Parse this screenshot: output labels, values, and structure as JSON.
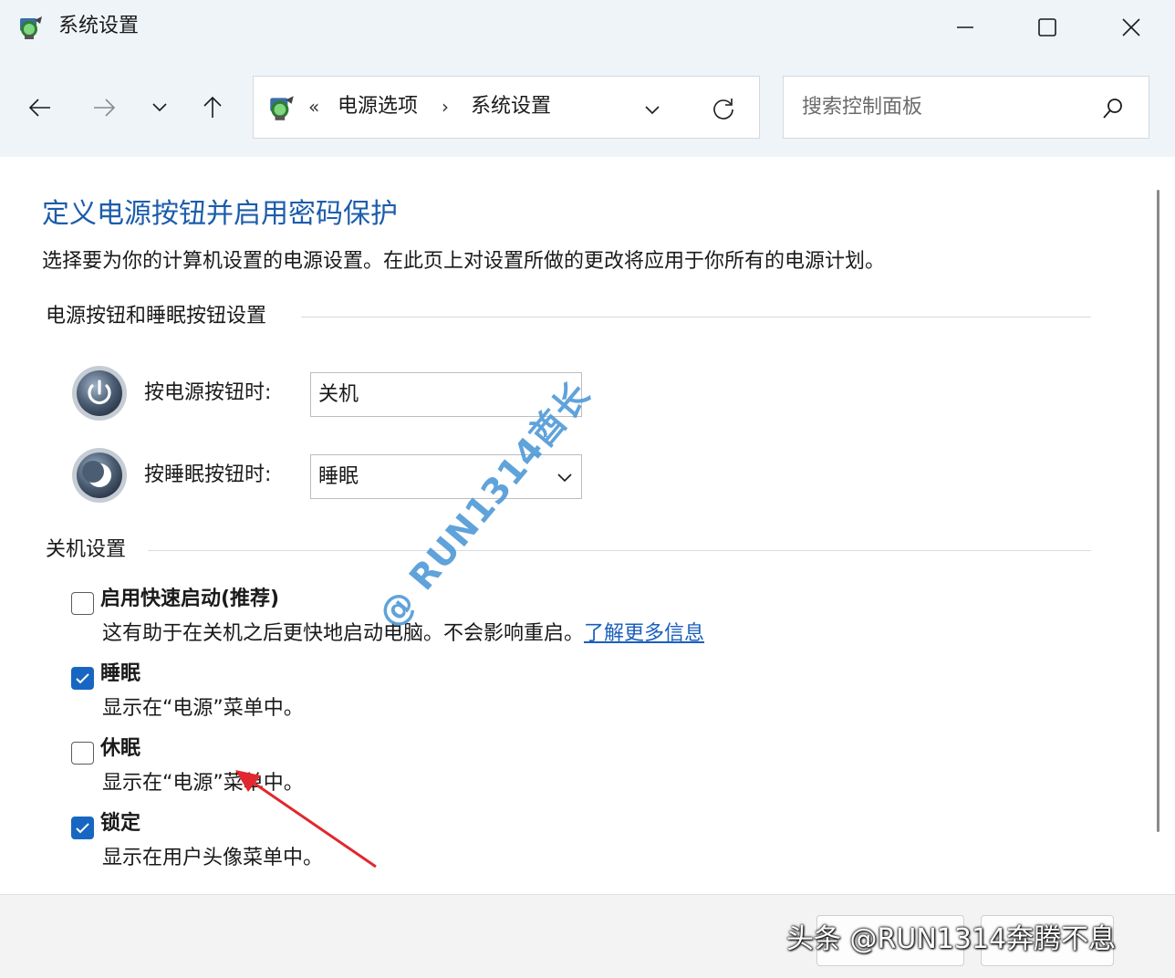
{
  "window": {
    "title": "系统设置"
  },
  "nav": {
    "breadcrumb_prefix": "«",
    "breadcrumb_parent": "电源选项",
    "breadcrumb_sep": "›",
    "breadcrumb_current": "系统设置"
  },
  "search": {
    "placeholder": "搜索控制面板"
  },
  "page": {
    "title": "定义电源按钮并启用密码保护",
    "description": "选择要为你的计算机设置的电源设置。在此页上对设置所做的更改将应用于你所有的电源计划。"
  },
  "power_section": {
    "heading": "电源按钮和睡眠按钮设置",
    "power_button": {
      "label": "按电源按钮时:",
      "value": "关机"
    },
    "sleep_button": {
      "label": "按睡眠按钮时:",
      "value": "睡眠"
    }
  },
  "shutdown_section": {
    "heading": "关机设置",
    "options": [
      {
        "label": "启用快速启动(推荐)",
        "desc": "这有助于在关机之后更快地启动电脑。不会影响重启。",
        "link": "了解更多信息",
        "checked": false
      },
      {
        "label": "睡眠",
        "desc": "显示在“电源”菜单中。",
        "checked": true
      },
      {
        "label": "休眠",
        "desc": "显示在“电源”菜单中。",
        "checked": false
      },
      {
        "label": "锁定",
        "desc": "显示在用户头像菜单中。",
        "checked": true
      }
    ]
  },
  "overlay": {
    "watermark": "@ RUN1314酋长",
    "credit": "头条 @RUN1314奔腾不息"
  },
  "colors": {
    "accent": "#1767c2",
    "title_blue": "#1c5cab",
    "link_blue": "#1a5fbd",
    "arrow_red": "#e0282e"
  }
}
